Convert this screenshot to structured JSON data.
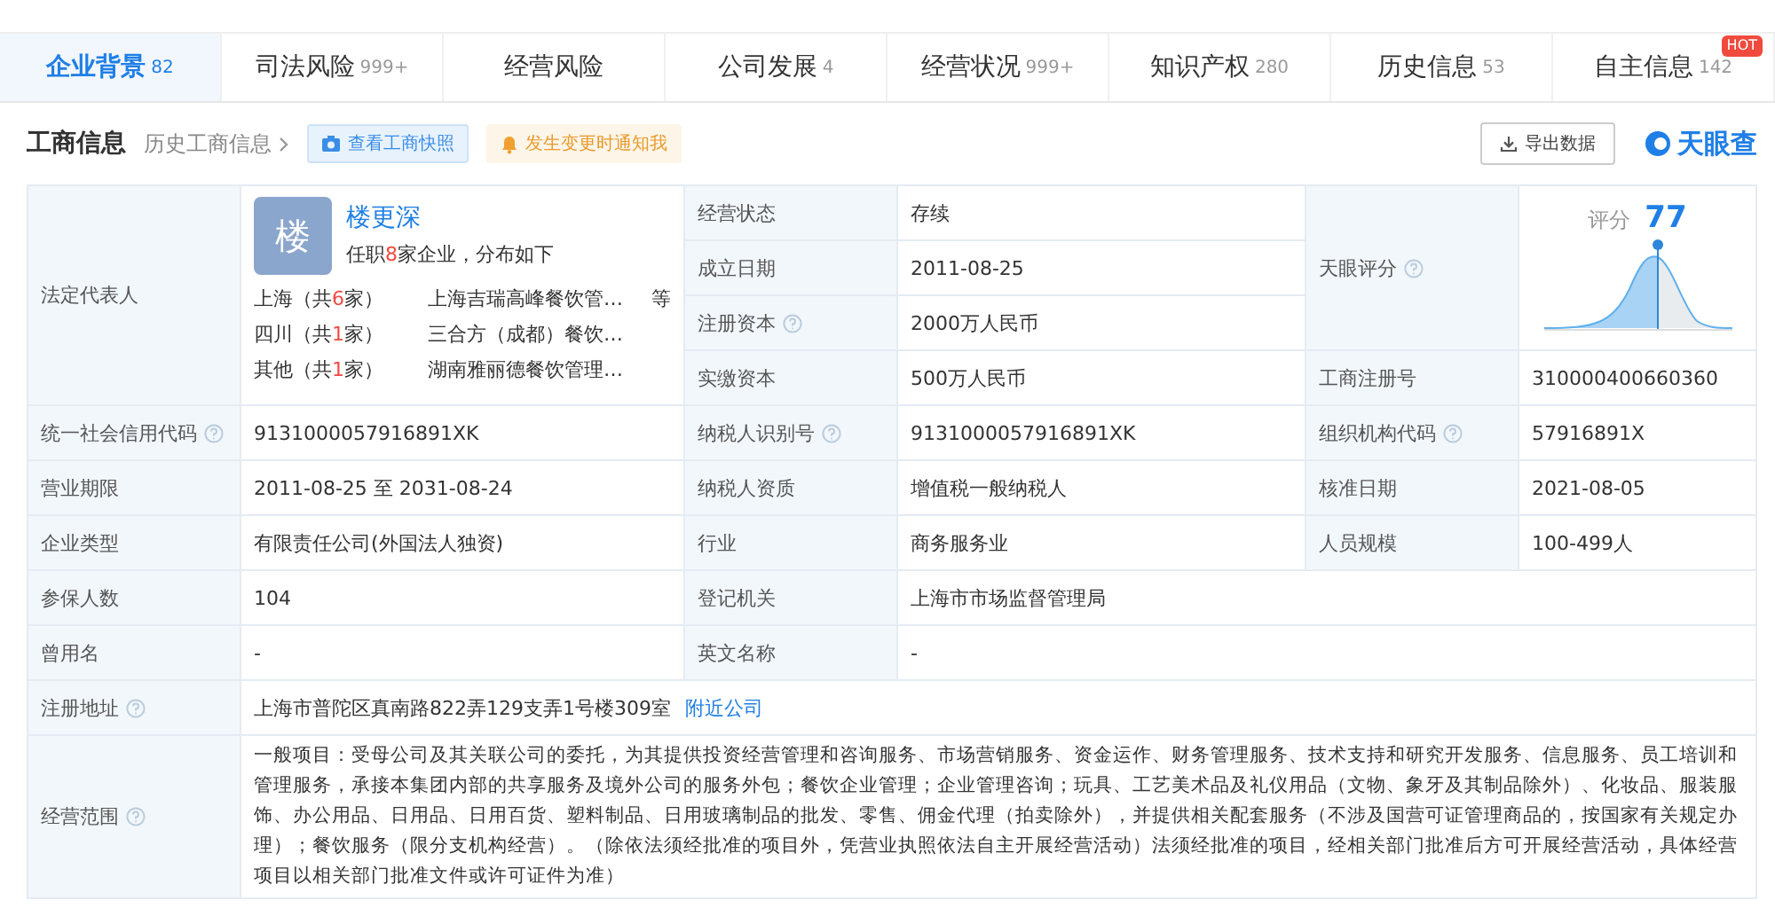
{
  "tabs": [
    {
      "label": "企业背景",
      "count": "82",
      "selected": true
    },
    {
      "label": "司法风险",
      "count": "999+",
      "selected": false
    },
    {
      "label": "经营风险",
      "selected": false
    },
    {
      "label": "公司发展",
      "count": "4",
      "selected": false
    },
    {
      "label": "经营状况",
      "count": "999+",
      "selected": false
    },
    {
      "label": "知识产权",
      "count": "280",
      "selected": false
    },
    {
      "label": "历史信息",
      "count": "53",
      "selected": false
    },
    {
      "label": "自主信息",
      "count": "142",
      "badge": "HOT",
      "selected": false
    }
  ],
  "section": {
    "title": "工商信息",
    "history_link": "历史工商信息",
    "snapshot_button": "查看工商快照",
    "notify_button": "发生变更时通知我",
    "export_button": "导出数据",
    "logo": "天眼查"
  },
  "legal_rep": {
    "label": "法定代表人",
    "avatar": "楼",
    "name": "楼更深",
    "summary_prefix": "任职",
    "summary_count": "8",
    "summary_suffix": "家企业，分布如下",
    "regions": [
      {
        "place": "上海（共",
        "count": "6",
        "unit": "家）",
        "company": "上海吉瑞高峰餐饮管…",
        "more": "等"
      },
      {
        "place": "四川（共",
        "count": "1",
        "unit": "家）",
        "company": "三合方（成都）餐饮…"
      },
      {
        "place": "其他（共",
        "count": "1",
        "unit": "家）",
        "company": "湖南雅丽德餐饮管理…"
      }
    ]
  },
  "top_fields": [
    {
      "label": "经营状态",
      "value": "存续",
      "help": false
    },
    {
      "label": "成立日期",
      "value": "2011-08-25",
      "help": false
    },
    {
      "label": "注册资本",
      "value": "2000万人民币",
      "help": true
    },
    {
      "label": "实缴资本",
      "value": "500万人民币",
      "help": false
    }
  ],
  "score": {
    "label": "天眼评分",
    "help": true,
    "caption": "评分",
    "value": "77"
  },
  "reg_no": {
    "label": "工商注册号",
    "value": "310000400660360",
    "help": false
  },
  "rows": [
    [
      {
        "label": "统一社会信用代码",
        "help": true,
        "value": "913100005791​6891XK"
      },
      {
        "label": "纳税人识别号",
        "help": true,
        "value": "913100005791​6891XK"
      },
      {
        "label": "组织机构代码",
        "help": true,
        "value": "57916891X"
      }
    ],
    [
      {
        "label": "营业期限",
        "help": false,
        "value": "2011-08-25 至 2031-08-24"
      },
      {
        "label": "纳税人资质",
        "help": false,
        "value": "增值税一般纳税人"
      },
      {
        "label": "核准日期",
        "help": false,
        "value": "2021-08-05"
      }
    ],
    [
      {
        "label": "企业类型",
        "help": false,
        "value": "有限责任公司(外国法人独资)"
      },
      {
        "label": "行业",
        "help": false,
        "value": "商务服务业"
      },
      {
        "label": "人员规模",
        "help": false,
        "value": "100-499人"
      }
    ],
    [
      {
        "label": "参保人数",
        "help": false,
        "value": "104"
      },
      {
        "label": "登记机关",
        "help": false,
        "value": "上海市市场监督管理局"
      }
    ],
    [
      {
        "label": "曾用名",
        "help": false,
        "value": "-"
      },
      {
        "label": "英文名称",
        "help": false,
        "value": "-"
      }
    ],
    [
      {
        "label": "注册地址",
        "help": true,
        "value": "上海市普陀区真南路822弄129支弄1号楼309室",
        "link": "附近公司"
      }
    ],
    [
      {
        "label": "经营范围",
        "help": true,
        "value": "一般项目：受母公司及其关联公司的委托，为其提供投资经营管理和咨询服务、市场营销服务、资金运作、财务管理服务、技术支持和研究开发服务、信息服务、员工培训和管理服务，承接本集团内部的共享服务及境外公司的服务外包；餐饮企业管理；企业管理咨询；玩具、工艺美术品及礼仪用品（文物、象牙及其制品除外）、化妆品、服装服饰、办公用品、日用品、日用百货、塑料制品、日用玻璃制品的批发、零售、佣金代理（拍卖除外），并提供相关配套服务（不涉及国营可证管理商品的，按国家有关规定办理）；餐饮服务（限分支机构经营）。（除依法须经批准的项目外，凭营业执照依法自主开展经营活动）法须经批准的项目，经相关部门批准后方可开展经营活动，具体经营项目以相关部门批准文件或许可证件为准）"
      }
    ]
  ]
}
